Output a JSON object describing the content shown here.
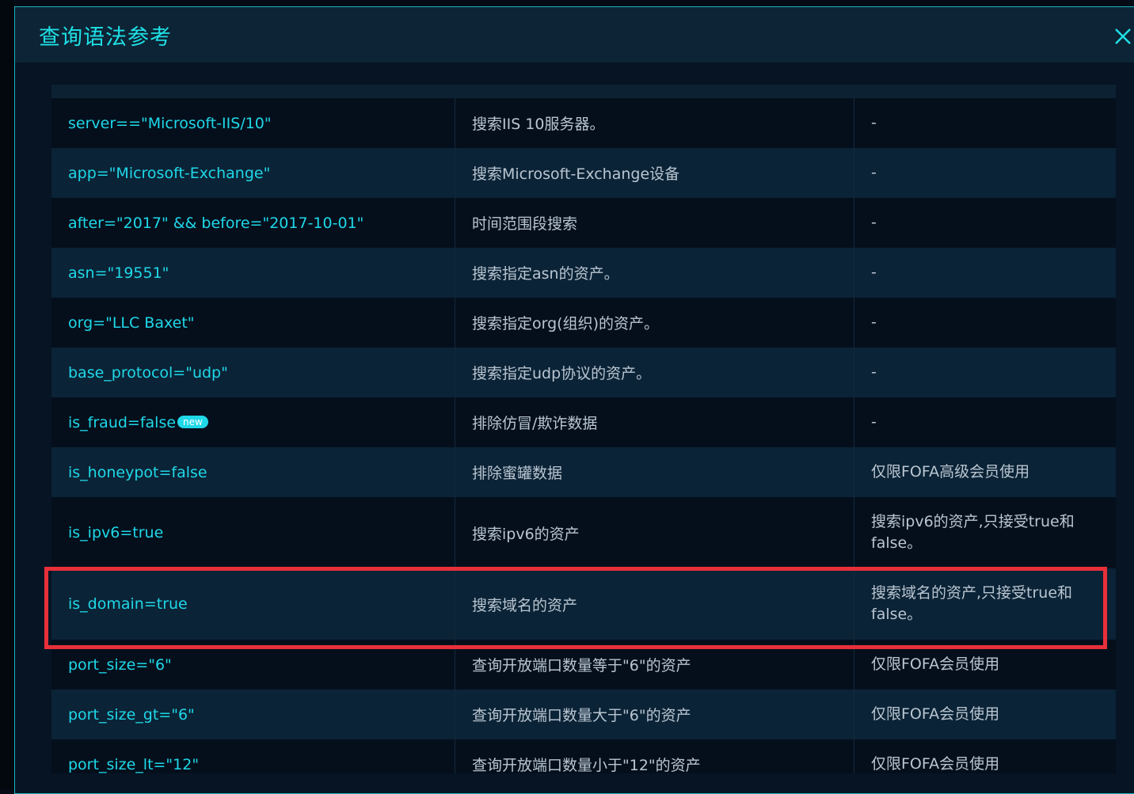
{
  "dialog": {
    "title": "查询语法参考"
  },
  "rows": [
    {
      "query": "server==\"Microsoft-IIS/10\"",
      "desc": "搜索IIS 10服务器。",
      "note": "-"
    },
    {
      "query": "app=\"Microsoft-Exchange\"",
      "desc": "搜索Microsoft-Exchange设备",
      "note": "-"
    },
    {
      "query": "after=\"2017\" && before=\"2017-10-01\"",
      "desc": "时间范围段搜索",
      "note": "-"
    },
    {
      "query": "asn=\"19551\"",
      "desc": "搜索指定asn的资产。",
      "note": "-"
    },
    {
      "query": "org=\"LLC Baxet\"",
      "desc": "搜索指定org(组织)的资产。",
      "note": "-"
    },
    {
      "query": "base_protocol=\"udp\"",
      "desc": "搜索指定udp协议的资产。",
      "note": "-"
    },
    {
      "query": "is_fraud=false",
      "badge": "new",
      "desc": "排除仿冒/欺诈数据",
      "note": "-"
    },
    {
      "query": "is_honeypot=false",
      "desc": "排除蜜罐数据",
      "note": "仅限FOFA高级会员使用"
    },
    {
      "query": "is_ipv6=true",
      "desc": "搜索ipv6的资产",
      "note": "搜索ipv6的资产,只接受true和false。"
    },
    {
      "query": "is_domain=true",
      "desc": "搜索域名的资产",
      "note": "搜索域名的资产,只接受true和false。"
    },
    {
      "query": "port_size=\"6\"",
      "desc": "查询开放端口数量等于\"6\"的资产",
      "note": "仅限FOFA会员使用"
    },
    {
      "query": "port_size_gt=\"6\"",
      "desc": "查询开放端口数量大于\"6\"的资产",
      "note": "仅限FOFA会员使用"
    },
    {
      "query": "port_size_lt=\"12\"",
      "desc": "查询开放端口数量小于\"12\"的资产",
      "note": "仅限FOFA会员使用"
    }
  ]
}
